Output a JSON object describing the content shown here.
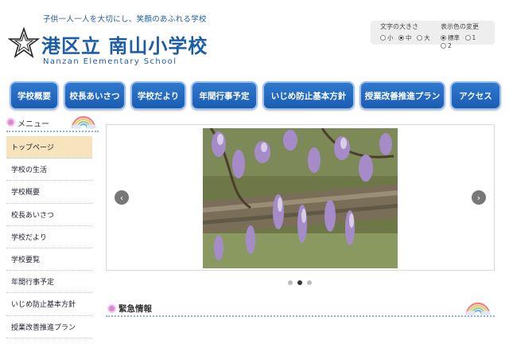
{
  "header": {
    "tagline": "子供一人一人を大切にし、笑顔のあふれる学校",
    "school_name": "港区立 南山小学校",
    "school_name_en": "Nanzan Elementary School",
    "logo": "star-emblem-icon"
  },
  "settings": {
    "font_size": {
      "title": "文字の大きさ",
      "options": [
        "小",
        "中",
        "大"
      ],
      "selected": "中"
    },
    "color": {
      "title": "表示色の変更",
      "options": [
        "標準",
        "1",
        "2"
      ],
      "selected": "標準"
    }
  },
  "nav": [
    "学校概要",
    "校長あいさつ",
    "学校だより",
    "年間行事予定",
    "いじめ防止基本方針",
    "授業改善推進プラン",
    "アクセス"
  ],
  "menu": {
    "title": "メニュー",
    "items": [
      "トップページ",
      "学校の生活",
      "学校概要",
      "校長あいさつ",
      "学校だより",
      "学校要覧",
      "年間行事予定",
      "いじめ防止基本方針",
      "授業改善推進プラン"
    ],
    "active": "トップページ"
  },
  "slider": {
    "image": "wisteria-photo",
    "prev": "‹",
    "next": "›",
    "count": 3,
    "current": 2
  },
  "emergency": {
    "title": "緊急情報"
  },
  "colors": {
    "brand_blue": "#1d5da8",
    "nav_blue": "#1f62b8",
    "menu_active": "#f7e4bd"
  }
}
